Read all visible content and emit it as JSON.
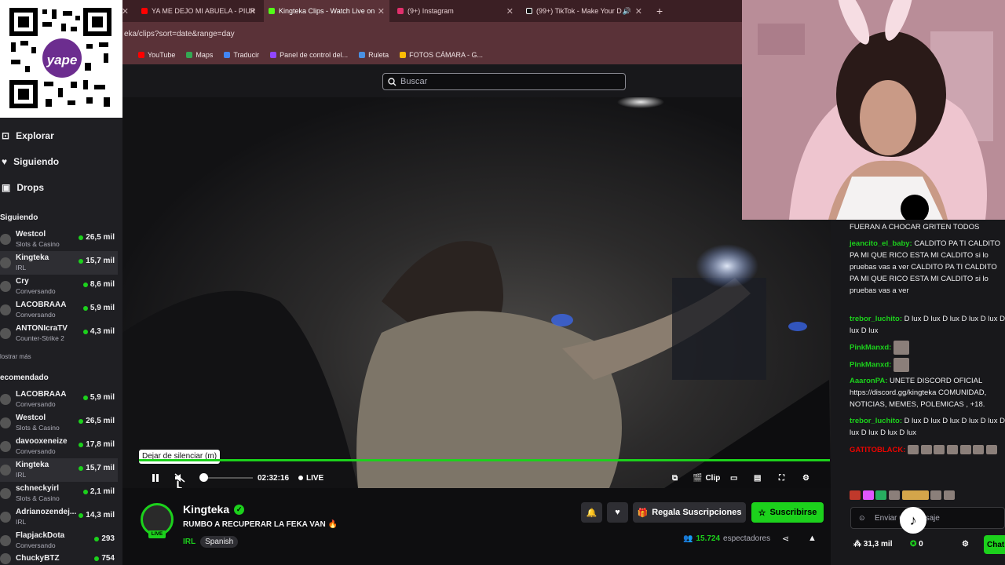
{
  "tabs": [
    {
      "label": "",
      "icon": "tab-close-icon"
    },
    {
      "label": "YA ME DEJO MI ABUELA - PIUR",
      "icon": "youtube-icon"
    },
    {
      "label": "Kingteka Clips - Watch Live on",
      "icon": "kick-icon"
    },
    {
      "label": "(9+) Instagram",
      "icon": "instagram-icon"
    },
    {
      "label": "(99+) TikTok - Make Your D",
      "icon": "tiktok-icon"
    }
  ],
  "address": "eka/clips?sort=date&range=day",
  "bookmarks": [
    "YouTube",
    "Maps",
    "Traducir",
    "Panel de control del...",
    "Ruleta",
    "FOTOS CÁMARA - G..."
  ],
  "qr_logo": "yape",
  "nav": [
    {
      "label": "Explorar",
      "icon": "compass-icon"
    },
    {
      "label": "Siguiendo",
      "icon": "heart-icon"
    },
    {
      "label": "Drops",
      "icon": "gift-icon"
    }
  ],
  "following_title": "Siguiendo",
  "following": [
    {
      "name": "Westcol",
      "category": "Slots & Casino",
      "viewers": "26,5 mil"
    },
    {
      "name": "Kingteka",
      "category": "IRL",
      "viewers": "15,7 mil"
    },
    {
      "name": "Cry",
      "category": "Conversando",
      "viewers": "8,6 mil"
    },
    {
      "name": "LACOBRAAA",
      "category": "Conversando",
      "viewers": "5,9 mil"
    },
    {
      "name": "ANTONIcraTV",
      "category": "Counter-Strike 2",
      "viewers": "4,3 mil"
    }
  ],
  "show_more": "lostrar más",
  "recommended_title": "ecomendado",
  "recommended": [
    {
      "name": "LACOBRAAA",
      "category": "Conversando",
      "viewers": "5,9 mil"
    },
    {
      "name": "Westcol",
      "category": "Slots & Casino",
      "viewers": "26,5 mil"
    },
    {
      "name": "davooxeneize",
      "category": "Conversando",
      "viewers": "17,8 mil"
    },
    {
      "name": "Kingteka",
      "category": "IRL",
      "viewers": "15,7 mil"
    },
    {
      "name": "schneckyirl",
      "category": "Slots & Casino",
      "viewers": "2,1 mil"
    },
    {
      "name": "Adrianozendej...",
      "category": "IRL",
      "viewers": "14,3 mil"
    },
    {
      "name": "FlapjackDota",
      "category": "Conversando",
      "viewers": "293"
    },
    {
      "name": "ChuckyBTZ",
      "category": "",
      "viewers": "754"
    }
  ],
  "search_placeholder": "Buscar",
  "player": {
    "tooltip": "Dejar de silenciar (m)",
    "time": "02:32:16",
    "live": "LIVE",
    "clip": "Clip",
    "progress": 1.0,
    "volume": 0.0
  },
  "stream": {
    "streamer": "Kingteka",
    "title": "RUMBO A RECUPERAR LA FEKA VAN 🔥",
    "category": "IRL",
    "tag": "Spanish",
    "live_badge": "LIVE",
    "gift_label": "Regala Suscripciones",
    "subscribe_label": "Suscribirse",
    "viewers": "15.724",
    "viewers_label": "espectadores"
  },
  "chat": {
    "messages": [
      {
        "user": "",
        "text": "FUERAN A CHOCAR GRITEN TODOS",
        "color": "#efeff1"
      },
      {
        "user": "jeancito_el_baby:",
        "text": "CALDITO PA TI CALDITO PA MI QUE RICO ESTA MI CALDITO si lo pruebas vas a ver CALDITO PA TI CALDITO PA MI QUE RICO ESTA MI CALDITO si lo pruebas vas a ver",
        "color": "#1cd11c"
      },
      {
        "user": "trebor_luchito:",
        "text": "D lux D lux D lux D lux D lux D lux D lux",
        "color": "#1cd11c"
      },
      {
        "user": "PinkManxd:",
        "text": "",
        "color": "#1cd11c"
      },
      {
        "user": "PinkManxd:",
        "text": "",
        "color": "#1cd11c"
      },
      {
        "user": "AaaronPA:",
        "text": "UNETE DISCORD OFICIAL https://discord.gg/kingteka COMUNIDAD, NOTICIAS, MEMES, POLEMICAS , +18.",
        "color": "#1cd11c"
      },
      {
        "user": "trebor_luchito:",
        "text": "D lux D lux D lux D lux D lux D lux D lux D lux D lux",
        "color": "#1cd11c"
      },
      {
        "user": "GATITOBLACK:",
        "text": "",
        "color": "#eb0400"
      }
    ],
    "input_placeholder": "Enviar un mensaje",
    "points": "31,3 mil",
    "count": "0",
    "chat_button": "Chat"
  },
  "colors": {
    "accent": "#1cd11c",
    "live": "#eb0400"
  }
}
